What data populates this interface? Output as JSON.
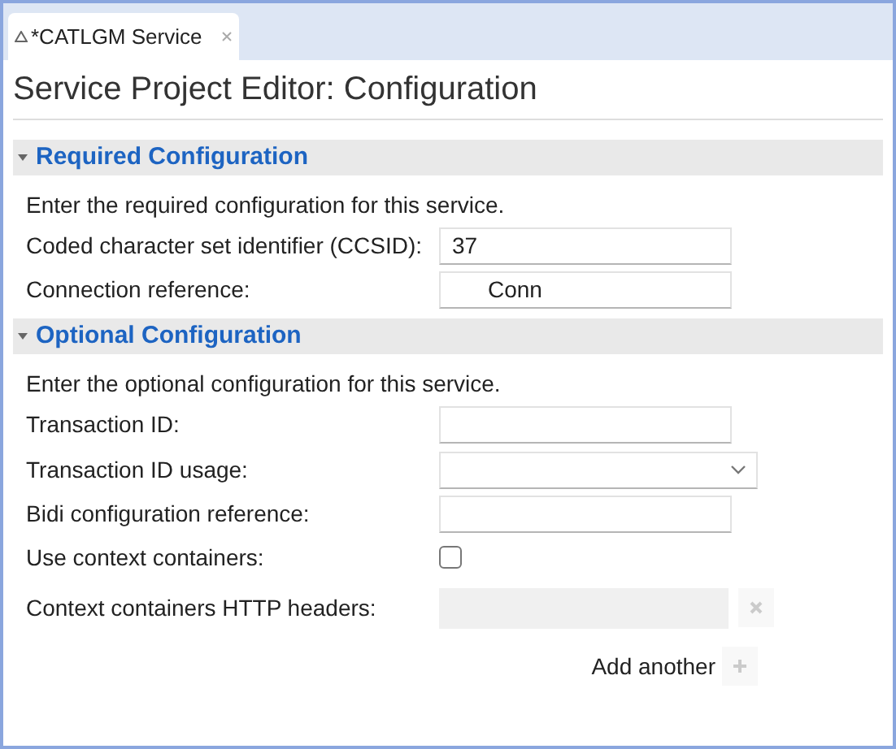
{
  "tab": {
    "label": "*CATLGM Service"
  },
  "title": "Service Project Editor: Configuration",
  "sections": [
    {
      "heading": "Required Configuration",
      "expanded": true,
      "description": "Enter the required configuration for this service.",
      "rows": [
        {
          "kind": "text",
          "label": "Coded character set identifier (CCSID):",
          "value": "37"
        },
        {
          "kind": "text",
          "label": "Connection reference:",
          "value": "Conn"
        }
      ]
    },
    {
      "heading": "Optional Configuration",
      "expanded": true,
      "description": "Enter the optional configuration for this service.",
      "rows": [
        {
          "kind": "text",
          "label": "Transaction ID:"
        },
        {
          "kind": "select",
          "label": "Transaction ID usage:"
        },
        {
          "kind": "text",
          "label": "Bidi configuration reference:"
        },
        {
          "kind": "checkbox",
          "label": "Use context containers:",
          "checked": false
        },
        {
          "kind": "list",
          "label": "Context containers HTTP headers:",
          "disabled": true
        },
        {
          "kind": "add",
          "label": "Add another",
          "disabled": true
        }
      ]
    }
  ]
}
